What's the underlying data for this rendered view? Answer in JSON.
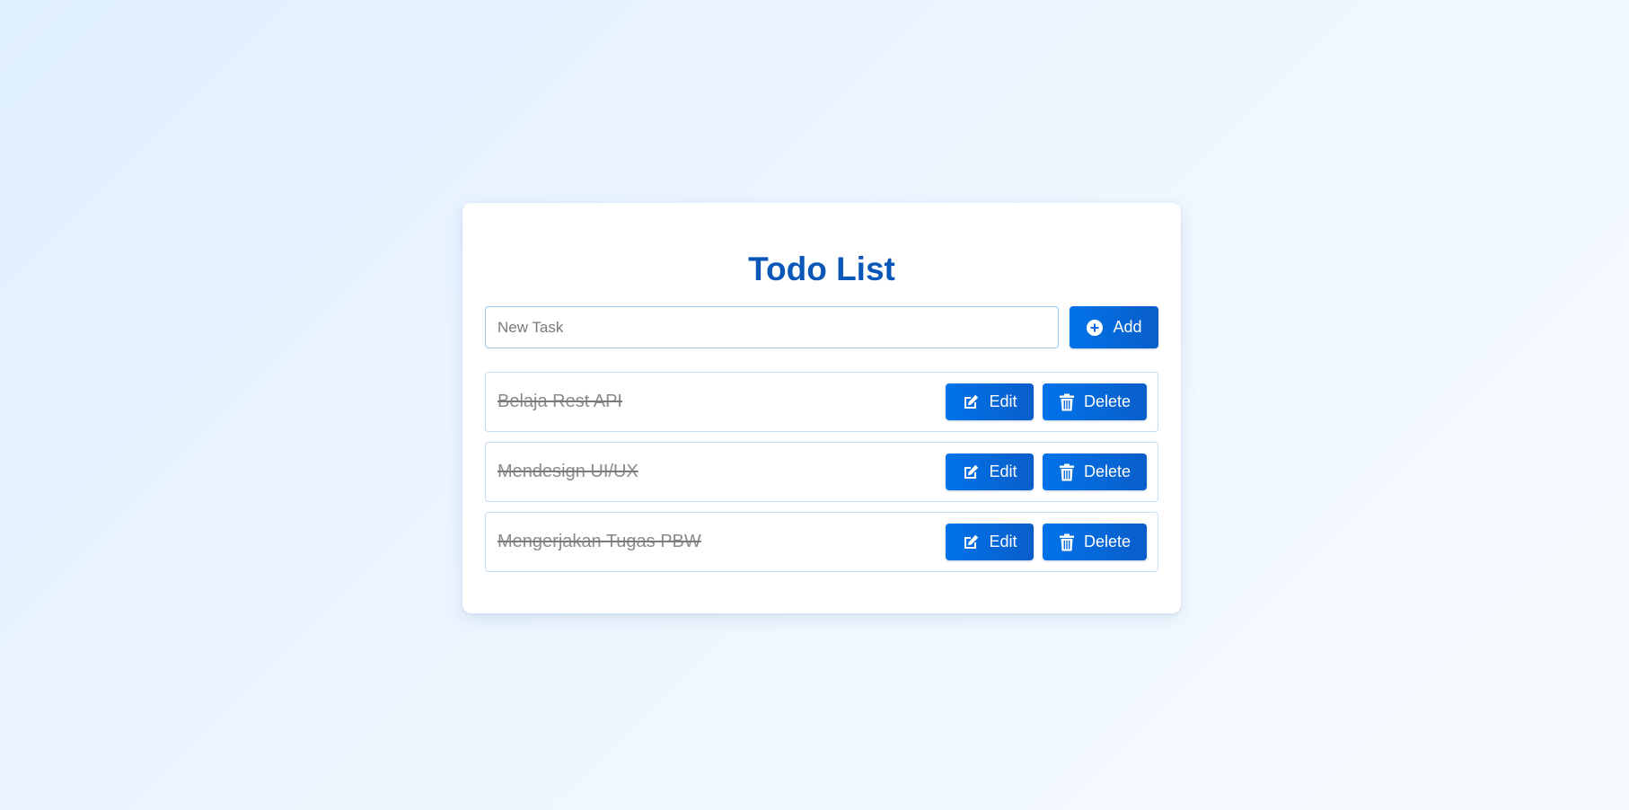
{
  "app": {
    "title": "Todo List"
  },
  "add_form": {
    "input_placeholder": "New Task",
    "input_value": "",
    "add_label": "Add",
    "add_icon": "plus-circle-icon"
  },
  "tasks": [
    {
      "text": "Belaja Rest API",
      "completed": true,
      "edit_label": "Edit",
      "delete_label": "Delete"
    },
    {
      "text": "Mendesign UI/UX",
      "completed": true,
      "edit_label": "Edit",
      "delete_label": "Delete"
    },
    {
      "text": "Mengerjakan Tugas PBW",
      "completed": true,
      "edit_label": "Edit",
      "delete_label": "Delete"
    }
  ],
  "icons": {
    "edit": "edit-icon",
    "delete": "trash-icon"
  },
  "colors": {
    "accent": "#0073ea",
    "title": "#0b57b7",
    "completed_text": "#8a8a8a"
  }
}
